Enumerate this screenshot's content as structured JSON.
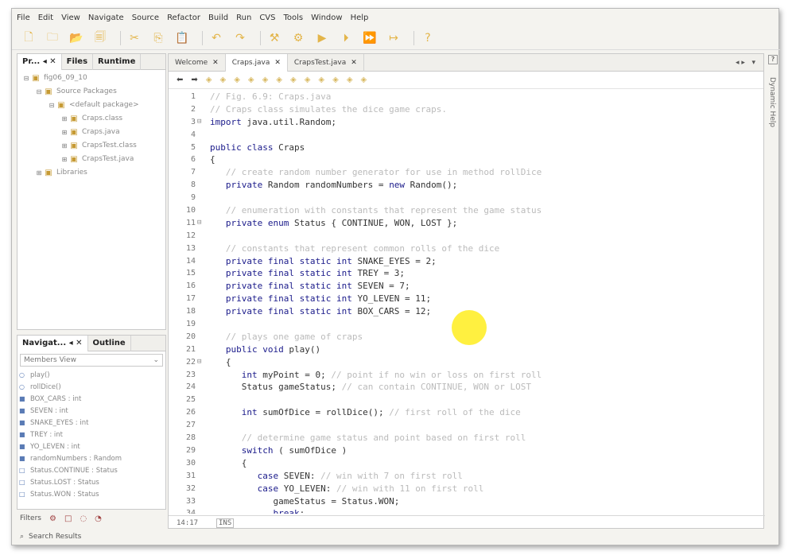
{
  "menubar": [
    "File",
    "Edit",
    "View",
    "Navigate",
    "Source",
    "Refactor",
    "Build",
    "Run",
    "CVS",
    "Tools",
    "Window",
    "Help"
  ],
  "toolbar_icons": [
    "new-file-icon",
    "new-project-icon",
    "open-project-icon",
    "save-all-icon",
    "cut-icon",
    "copy-icon",
    "paste-icon",
    "undo-icon",
    "redo-icon",
    "clean-build-icon",
    "build-icon",
    "run-icon",
    "debug-icon",
    "profile-icon",
    "step-icon",
    "help-icon"
  ],
  "project_panel": {
    "tabs": [
      "Pr...",
      "Files",
      "Runtime"
    ],
    "tree": [
      {
        "indent": 0,
        "exp": "⊟",
        "label": "fig06_09_10"
      },
      {
        "indent": 1,
        "exp": "⊟",
        "label": "Source Packages"
      },
      {
        "indent": 2,
        "exp": "⊟",
        "label": "<default package>"
      },
      {
        "indent": 3,
        "exp": "⊞",
        "label": "Craps.class"
      },
      {
        "indent": 3,
        "exp": "⊞",
        "label": "Craps.java"
      },
      {
        "indent": 3,
        "exp": "⊞",
        "label": "CrapsTest.class"
      },
      {
        "indent": 3,
        "exp": "⊞",
        "label": "CrapsTest.java"
      },
      {
        "indent": 1,
        "exp": "⊞",
        "label": "Libraries"
      }
    ]
  },
  "navigator_panel": {
    "tabs": [
      "Navigat...",
      "Outline"
    ],
    "view": "Members View",
    "members": [
      {
        "icon": "○",
        "label": "play()"
      },
      {
        "icon": "○",
        "label": "rollDice()"
      },
      {
        "icon": "■",
        "label": "BOX_CARS : int"
      },
      {
        "icon": "■",
        "label": "SEVEN : int"
      },
      {
        "icon": "■",
        "label": "SNAKE_EYES : int"
      },
      {
        "icon": "■",
        "label": "TREY : int"
      },
      {
        "icon": "■",
        "label": "YO_LEVEN : int"
      },
      {
        "icon": "■",
        "label": "randomNumbers : Random"
      },
      {
        "icon": "□",
        "label": "Status.CONTINUE : Status"
      },
      {
        "icon": "□",
        "label": "Status.LOST : Status"
      },
      {
        "icon": "□",
        "label": "Status.WON : Status"
      }
    ]
  },
  "filters_label": "Filters",
  "search_results_label": "Search Results",
  "editor": {
    "tabs": [
      {
        "label": "Welcome",
        "active": false
      },
      {
        "label": "Craps.java",
        "active": true
      },
      {
        "label": "CrapsTest.java",
        "active": false
      }
    ],
    "lines": [
      {
        "n": "1",
        "fold": "",
        "html": "<span class='cm'>// Fig. 6.9: Craps.java</span>"
      },
      {
        "n": "2",
        "fold": "",
        "html": "<span class='cm'>// Craps class simulates the dice game craps.</span>"
      },
      {
        "n": "3",
        "fold": "⊟",
        "html": "<span class='kw'>import</span> java.util.Random;"
      },
      {
        "n": "4",
        "fold": "",
        "html": ""
      },
      {
        "n": "5",
        "fold": "",
        "html": "<span class='kw'>public class</span> Craps"
      },
      {
        "n": "6",
        "fold": "",
        "html": "{"
      },
      {
        "n": "7",
        "fold": "",
        "html": "   <span class='cm'>// create random number generator for use in method rollDice</span>"
      },
      {
        "n": "8",
        "fold": "",
        "html": "   <span class='kw'>private</span> Random randomNumbers = <span class='kw'>new</span> Random();"
      },
      {
        "n": "9",
        "fold": "",
        "html": ""
      },
      {
        "n": "10",
        "fold": "",
        "html": "   <span class='cm'>// enumeration with constants that represent the game status</span>"
      },
      {
        "n": "11",
        "fold": "⊟",
        "html": "   <span class='kw'>private enum</span> Status { CONTINUE, WON, LOST };"
      },
      {
        "n": "12",
        "fold": "",
        "html": ""
      },
      {
        "n": "13",
        "fold": "",
        "html": "   <span class='cm'>// constants that represent common rolls of the dice</span>"
      },
      {
        "n": "14",
        "fold": "",
        "html": "   <span class='kw'>private final static int</span> SNAKE_EYES = 2;"
      },
      {
        "n": "15",
        "fold": "",
        "html": "   <span class='kw'>private final static int</span> TREY = 3;"
      },
      {
        "n": "16",
        "fold": "",
        "html": "   <span class='kw'>private final static int</span> SEVEN = 7;"
      },
      {
        "n": "17",
        "fold": "",
        "html": "   <span class='kw'>private final static int</span> YO_LEVEN = 11;"
      },
      {
        "n": "18",
        "fold": "",
        "html": "   <span class='kw'>private final static int</span> BOX_CARS = 12;"
      },
      {
        "n": "19",
        "fold": "",
        "html": ""
      },
      {
        "n": "20",
        "fold": "",
        "html": "   <span class='cm'>// plays one game of craps</span>"
      },
      {
        "n": "21",
        "fold": "",
        "html": "   <span class='kw'>public void</span> play()"
      },
      {
        "n": "22",
        "fold": "⊟",
        "html": "   {"
      },
      {
        "n": "23",
        "fold": "",
        "html": "      <span class='kw'>int</span> myPoint = 0; <span class='cm'>// point if no win or loss on first roll</span>"
      },
      {
        "n": "24",
        "fold": "",
        "html": "      Status gameStatus; <span class='cm'>// can contain CONTINUE, WON or LOST</span>"
      },
      {
        "n": "25",
        "fold": "",
        "html": ""
      },
      {
        "n": "26",
        "fold": "",
        "html": "      <span class='kw'>int</span> sumOfDice = rollDice(); <span class='cm'>// first roll of the dice</span>"
      },
      {
        "n": "27",
        "fold": "",
        "html": ""
      },
      {
        "n": "28",
        "fold": "",
        "html": "      <span class='cm'>// determine game status and point based on first roll</span>"
      },
      {
        "n": "29",
        "fold": "",
        "html": "      <span class='kw'>switch</span> ( sumOfDice )"
      },
      {
        "n": "30",
        "fold": "",
        "html": "      {"
      },
      {
        "n": "31",
        "fold": "",
        "html": "         <span class='kw'>case</span> SEVEN: <span class='cm'>// win with 7 on first roll</span>"
      },
      {
        "n": "32",
        "fold": "",
        "html": "         <span class='kw'>case</span> YO_LEVEN: <span class='cm'>// win with 11 on first roll</span>"
      },
      {
        "n": "33",
        "fold": "",
        "html": "            gameStatus = Status.WON;"
      },
      {
        "n": "34",
        "fold": "",
        "html": "            <span class='kw'>break</span>;"
      }
    ]
  },
  "status": {
    "position": "14:17",
    "mode": "INS"
  },
  "right_strip": {
    "label": "Dynamic Help",
    "icon_text": "?"
  }
}
